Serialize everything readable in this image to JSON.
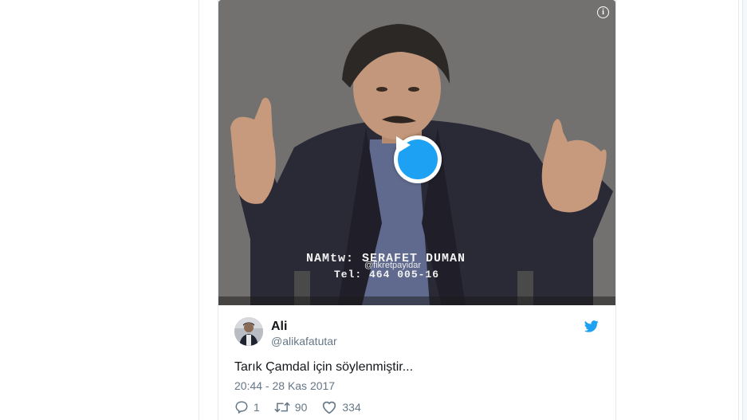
{
  "tweet": {
    "author_name": "Ali",
    "author_handle": "@alikafatutar",
    "text": "Tarık Çamdal için söylenmiştir...",
    "timestamp": "20:44 - 28 Kas 2017"
  },
  "media": {
    "caption_line1": "NAMtw: SERAFET DUMAN",
    "caption_line2": "Tel: 464 005-16",
    "watermark": "@fikretpayidar",
    "info_icon_glyph": "i"
  },
  "actions": {
    "replies": "1",
    "retweets": "90",
    "likes": "334"
  },
  "icons": {
    "play": "play-icon",
    "info": "info-icon",
    "bird": "twitter-bird-icon",
    "reply": "reply-icon",
    "retweet": "retweet-icon",
    "like": "heart-icon"
  },
  "colors": {
    "accent": "#1da1f2",
    "text": "#14171a",
    "muted": "#657786",
    "border": "#e1e8ed"
  }
}
